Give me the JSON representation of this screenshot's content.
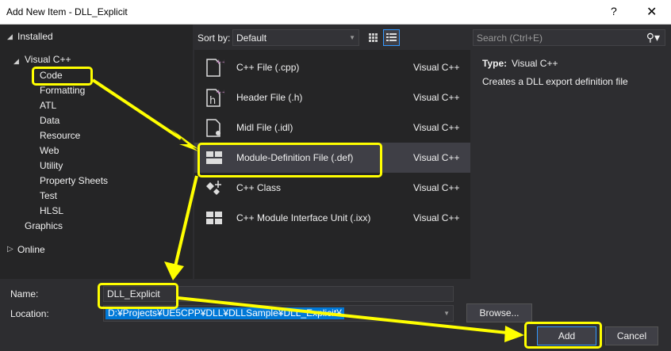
{
  "window": {
    "title": "Add New Item - DLL_Explicit",
    "help": "?",
    "close": "✕"
  },
  "tree": {
    "installed": "Installed",
    "visual_cpp": "Visual C++",
    "children": [
      "Code",
      "Formatting",
      "ATL",
      "Data",
      "Resource",
      "Web",
      "Utility",
      "Property Sheets",
      "Test",
      "HLSL"
    ],
    "graphics": "Graphics",
    "online": "Online"
  },
  "sort": {
    "label": "Sort by:",
    "value": "Default"
  },
  "search": {
    "placeholder": "Search (Ctrl+E)"
  },
  "templates": [
    {
      "name": "C++ File (.cpp)",
      "lang": "Visual C++",
      "icon": "cpp-file-icon"
    },
    {
      "name": "Header File (.h)",
      "lang": "Visual C++",
      "icon": "header-file-icon"
    },
    {
      "name": "Midl File (.idl)",
      "lang": "Visual C++",
      "icon": "idl-file-icon"
    },
    {
      "name": "Module-Definition File (.def)",
      "lang": "Visual C++",
      "icon": "module-def-icon"
    },
    {
      "name": "C++ Class",
      "lang": "Visual C++",
      "icon": "cpp-class-icon"
    },
    {
      "name": "C++ Module Interface Unit (.ixx)",
      "lang": "Visual C++",
      "icon": "module-interface-icon"
    }
  ],
  "details": {
    "type_label": "Type:",
    "type_value": "Visual C++",
    "description": "Creates a DLL export definition file"
  },
  "form": {
    "name_label": "Name:",
    "name_value": "DLL_Explicit",
    "location_label": "Location:",
    "location_value": "D:¥Projects¥UE5CPP¥DLL¥DLLSample¥DLL_Explicit¥",
    "browse": "Browse...",
    "add": "Add",
    "cancel": "Cancel"
  },
  "colors": {
    "highlight": "#ffff00",
    "accent": "#3399ff",
    "selection": "#0078d7"
  }
}
